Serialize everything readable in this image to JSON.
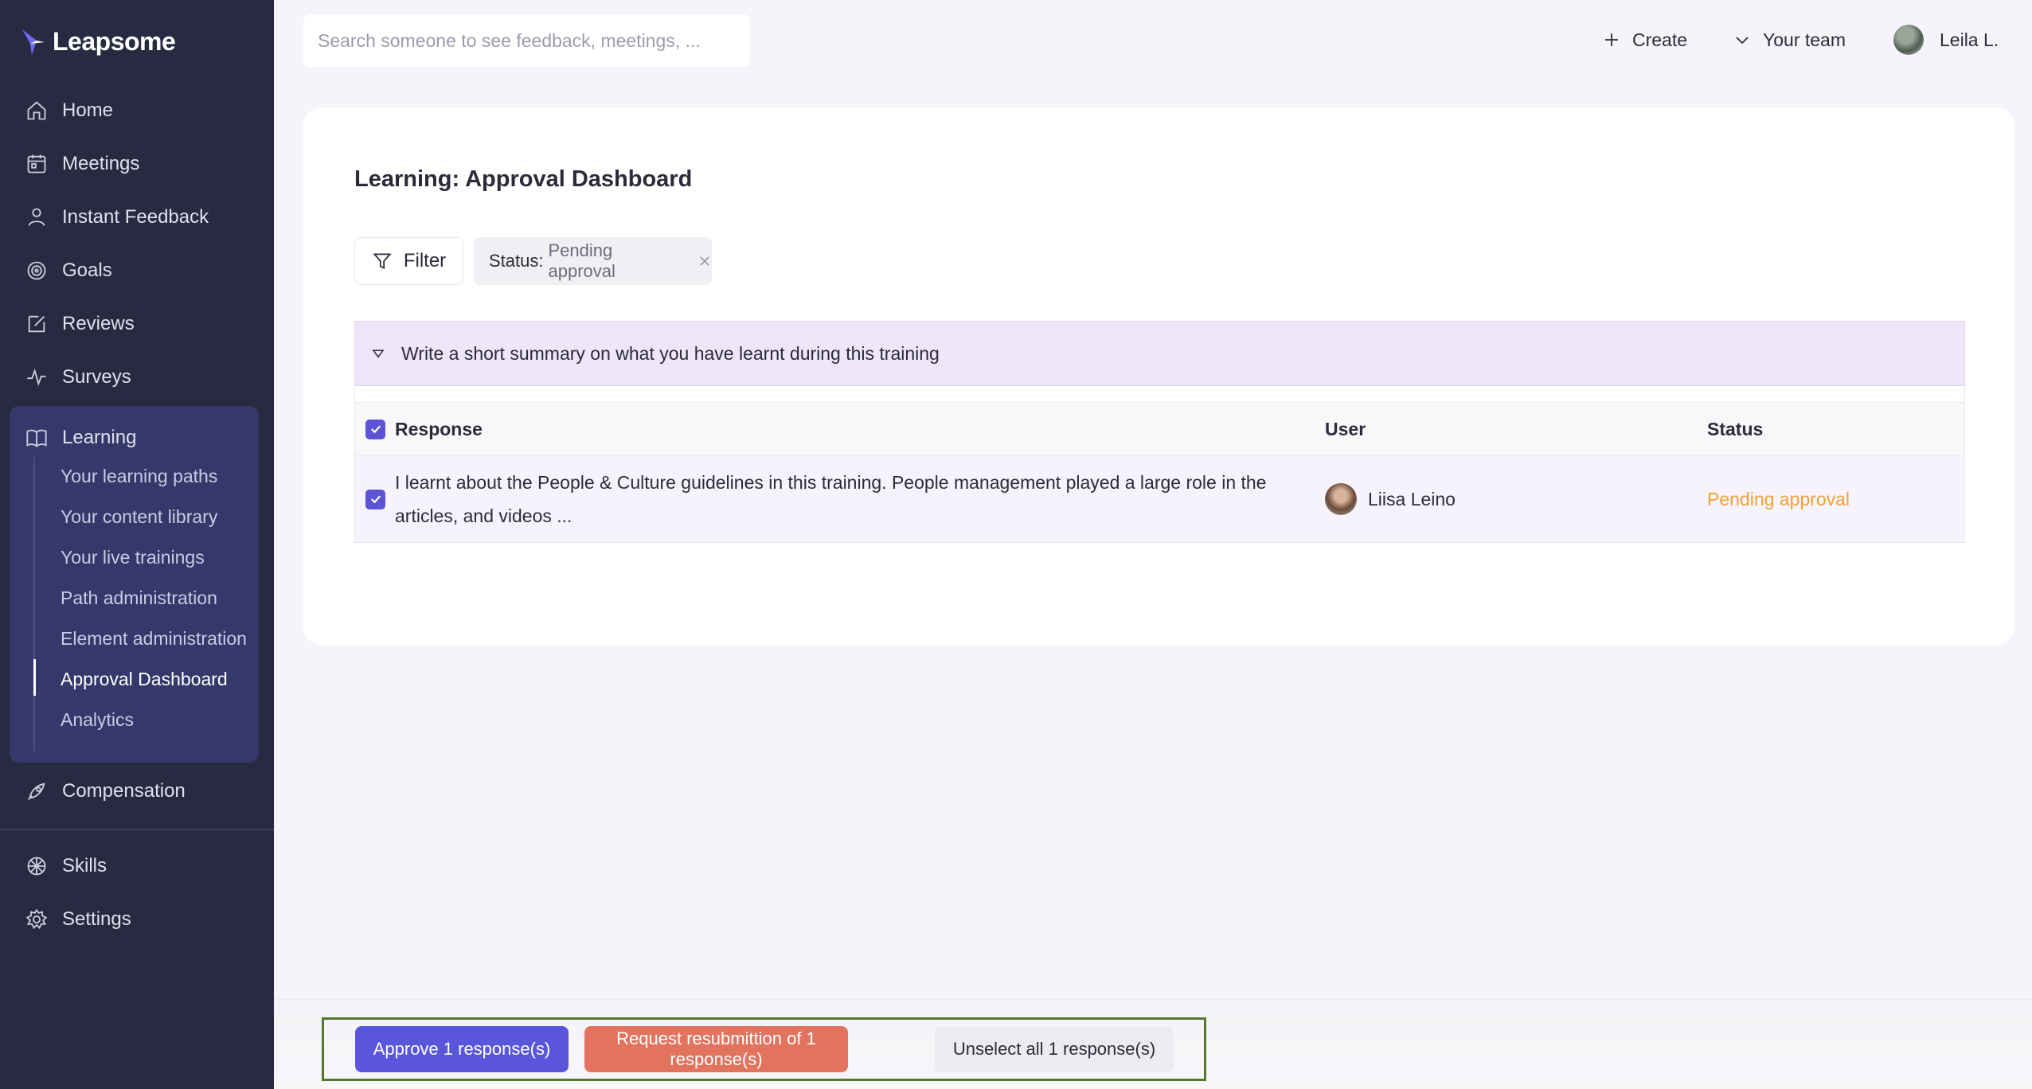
{
  "app": {
    "name": "Leapsome"
  },
  "sidebar": {
    "items": [
      {
        "label": "Home"
      },
      {
        "label": "Meetings"
      },
      {
        "label": "Instant Feedback"
      },
      {
        "label": "Goals"
      },
      {
        "label": "Reviews"
      },
      {
        "label": "Surveys"
      },
      {
        "label": "Learning"
      },
      {
        "label": "Compensation"
      },
      {
        "label": "Skills"
      },
      {
        "label": "Settings"
      }
    ],
    "learning_sub": [
      {
        "label": "Your learning paths"
      },
      {
        "label": "Your content library"
      },
      {
        "label": "Your live trainings"
      },
      {
        "label": "Path administration"
      },
      {
        "label": "Element administration"
      },
      {
        "label": "Approval Dashboard"
      },
      {
        "label": "Analytics"
      }
    ]
  },
  "topbar": {
    "search_placeholder": "Search someone to see feedback, meetings, ...",
    "create_label": "Create",
    "team_label": "Your team",
    "user_label": "Leila L."
  },
  "main": {
    "title": "Learning: Approval Dashboard",
    "filter_label": "Filter",
    "status_chip": {
      "key": "Status:",
      "value": "Pending approval"
    },
    "question": "Write a short summary on what you have learnt during this training",
    "table": {
      "columns": [
        "Response",
        "User",
        "Status"
      ],
      "rows": [
        {
          "response": "I learnt about the People & Culture guidelines in this training. People management played a large role in the articles, and videos ...",
          "user": "Liisa Leino",
          "status": "Pending approval"
        }
      ]
    }
  },
  "actions": {
    "approve": "Approve 1 response(s)",
    "resubmit": "Request resubmittion of 1 response(s)",
    "unselect": "Unselect all 1 response(s)"
  },
  "colors": {
    "sidebar_bg": "#282a41",
    "accent": "#5a56db",
    "danger": "#e2735e",
    "pending": "#f0a233"
  }
}
